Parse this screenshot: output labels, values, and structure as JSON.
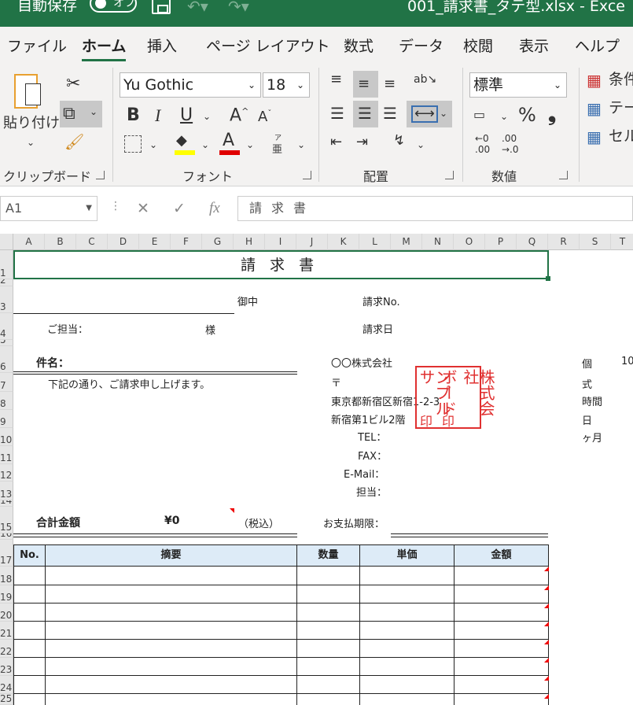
{
  "titlebar": {
    "autosave": "自動保存",
    "toggle_state": "オフ",
    "filename": "001_請求書_タテ型.xlsx  -  Exce"
  },
  "tabs": [
    "ファイル",
    "ホーム",
    "挿入",
    "ページ レイアウト",
    "数式",
    "データ",
    "校閲",
    "表示",
    "ヘルプ"
  ],
  "ribbon": {
    "paste": "貼り付け",
    "font_name": "Yu Gothic",
    "font_size": "18",
    "bold": "B",
    "italic": "I",
    "underline": "U",
    "grow": "A",
    "shrink": "A",
    "font_color_a": "A",
    "phonetic_top": "ア",
    "phonetic_bot": "亜",
    "number_format": "標準",
    "percent": "%",
    "comma": "❟",
    "dec_inc_top": "←0",
    "dec_inc_bot": ".00",
    "dec_dec_top": ".00",
    "dec_dec_bot": "→.0",
    "cond_format": "条件",
    "table_format": "テー",
    "cell_styles": "セル",
    "groups": {
      "clipboard": "クリップボード",
      "font": "フォント",
      "alignment": "配置",
      "number": "数値"
    }
  },
  "formula_bar": {
    "cell": "A1",
    "value": "請求書"
  },
  "columns": [
    "A",
    "B",
    "C",
    "D",
    "E",
    "F",
    "G",
    "H",
    "I",
    "J",
    "K",
    "L",
    "M",
    "N",
    "O",
    "P",
    "Q",
    "R",
    "S",
    "T"
  ],
  "rows": [
    "1",
    "2",
    "3",
    "4",
    "5",
    "6",
    "7",
    "8",
    "9",
    "10",
    "11",
    "12",
    "13",
    "14",
    "15",
    "16",
    "17",
    "18",
    "19",
    "20",
    "21",
    "22",
    "23",
    "24",
    "25"
  ],
  "sheet": {
    "title": "請 求 書",
    "onchu": "御中",
    "invoice_no": "請求No.",
    "tantou": "ご担当：",
    "sama": "様",
    "invoice_date": "請求日",
    "kenmei": "件名：",
    "company": "〇〇株式会社",
    "postal": "〒",
    "address1": "東京都新宿区新宿1-2-3",
    "address2": "新宿第1ビル2階",
    "tel": "TEL：",
    "fax": "FAX：",
    "email": "E-Mail：",
    "staff": "担当：",
    "message": "下記の通り、ご請求申し上げます。",
    "total_label": "合計金額",
    "total_value": "¥0",
    "tax": "（税込）",
    "due": "お支払期限：",
    "side_s6": "個",
    "side_t6": "10",
    "side_s7": "式",
    "side_s8": "時間",
    "side_s9": "日",
    "side_s10": "ヶ月",
    "stamp": {
      "col1": "株式会社",
      "col2": "ボード",
      "col3": "ンプルサ",
      "tail1": "印",
      "tail2": "印"
    },
    "table_headers": [
      "No.",
      "摘要",
      "数量",
      "単価",
      "金額"
    ]
  },
  "colors": {
    "excel_green": "#217346",
    "header_fill": "#ddebf7",
    "stamp_red": "#e03030"
  }
}
